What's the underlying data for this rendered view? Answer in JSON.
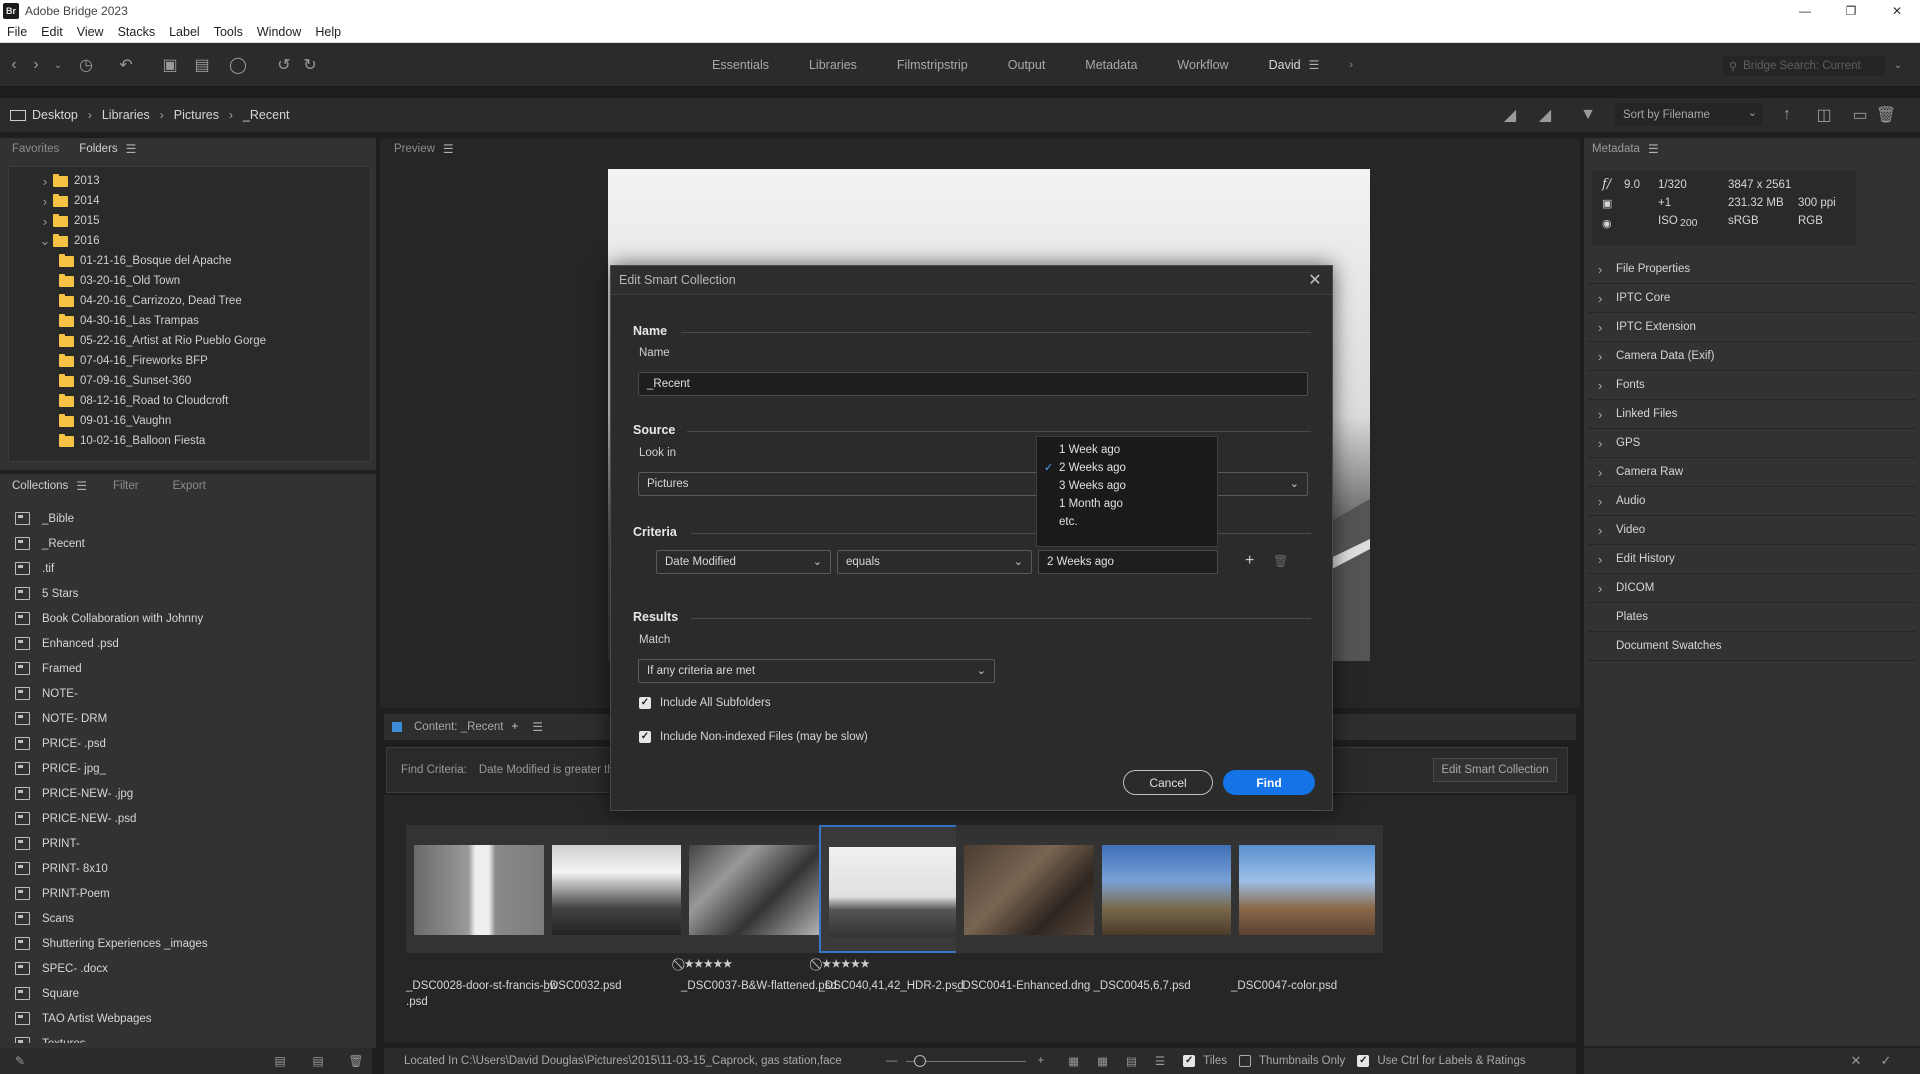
{
  "app": {
    "logo": "Br",
    "title": "Adobe Bridge 2023"
  },
  "menu": [
    "File",
    "Edit",
    "View",
    "Stacks",
    "Label",
    "Tools",
    "Window",
    "Help"
  ],
  "workspaces": [
    {
      "label": "Essentials",
      "active": false
    },
    {
      "label": "Libraries",
      "active": false
    },
    {
      "label": "Filmstripstrip",
      "active": false
    },
    {
      "label": "Output",
      "active": false
    },
    {
      "label": "Metadata",
      "active": false
    },
    {
      "label": "Workflow",
      "active": false
    },
    {
      "label": "David",
      "active": true
    }
  ],
  "search": {
    "placeholder": "Bridge Search: Current"
  },
  "breadcrumb": [
    "Desktop",
    "Libraries",
    "Pictures",
    "_Recent"
  ],
  "sort": {
    "label": "Sort by Filename"
  },
  "left_tabs": {
    "favorites": "Favorites",
    "folders": "Folders"
  },
  "folders": [
    {
      "label": "2013",
      "expanded": false,
      "indent": 0
    },
    {
      "label": "2014",
      "expanded": false,
      "indent": 0
    },
    {
      "label": "2015",
      "expanded": false,
      "indent": 0
    },
    {
      "label": "2016",
      "expanded": true,
      "indent": 0
    },
    {
      "label": "01-21-16_Bosque del Apache",
      "indent": 1
    },
    {
      "label": "03-20-16_Old Town",
      "indent": 1
    },
    {
      "label": "04-20-16_Carrizozo, Dead Tree",
      "indent": 1
    },
    {
      "label": "04-30-16_Las Trampas",
      "indent": 1
    },
    {
      "label": "05-22-16_Artist at Rio Pueblo Gorge",
      "indent": 1
    },
    {
      "label": "07-04-16_Fireworks BFP",
      "indent": 1
    },
    {
      "label": "07-09-16_Sunset-360",
      "indent": 1
    },
    {
      "label": "08-12-16_Road to Cloudcroft",
      "indent": 1
    },
    {
      "label": "09-01-16_Vaughn",
      "indent": 1
    },
    {
      "label": "10-02-16_Balloon Fiesta",
      "indent": 1
    }
  ],
  "collection_tabs": {
    "collections": "Collections",
    "filter": "Filter",
    "export": "Export"
  },
  "collections": [
    "_Bible",
    "_Recent",
    ".tif",
    "5 Stars",
    "Book Collaboration with Johnny",
    "Enhanced .psd",
    "Framed",
    "NOTE-",
    "NOTE- DRM",
    "PRICE- .psd",
    "PRICE- jpg_",
    "PRICE-NEW- .jpg",
    "PRICE-NEW- .psd",
    "PRINT-",
    "PRINT- 8x10",
    "PRINT-Poem",
    "Scans",
    "Shuttering Experiences _images",
    "SPEC- .docx",
    "Square",
    "TAO Artist Webpages",
    "Textures"
  ],
  "preview": {
    "label": "Preview"
  },
  "content": {
    "label": "Content: _Recent"
  },
  "find_bar": {
    "label": "Find Criteria:",
    "value": "Date Modified is greater th",
    "edit_button": "Edit Smart Collection"
  },
  "thumbnails": [
    {
      "caption": "_DSC0028-door-st-francis-bw .psd",
      "stars": "",
      "selected": false,
      "tone": "door"
    },
    {
      "caption": "_DSC0032.psd",
      "stars": "",
      "selected": false,
      "tone": "sky"
    },
    {
      "caption": "_DSC0037-B&W-flattened.psd",
      "stars": "⃠ ★★★★★",
      "selected": false,
      "tone": "trees"
    },
    {
      "caption": "_DSC040,41,42_HDR-2.psd",
      "stars": "⃠ ★★★★★",
      "selected": true,
      "tone": "road"
    },
    {
      "caption": "_DSC0041-Enhanced.dng",
      "stars": "",
      "selected": false,
      "tone": "rock"
    },
    {
      "caption": "_DSC0045,6,7.psd",
      "stars": "",
      "selected": false,
      "tone": "house"
    },
    {
      "caption": "_DSC0047-color.psd",
      "stars": "",
      "selected": false,
      "tone": "house2"
    }
  ],
  "status": {
    "path": "Located In C:\\Users\\David Douglas\\Pictures\\2015\\11-03-15_Caprock, gas station,face",
    "tiles": "Tiles",
    "thumbnails_only": "Thumbnails Only",
    "ctrl_hint": "Use Ctrl for Labels & Ratings"
  },
  "metadata": {
    "label": "Metadata",
    "aperture": "9.0",
    "shutter": "1/320",
    "exposure": "+1",
    "iso": "200",
    "iso_label": "ISO",
    "dimensions": "3847 x 2561",
    "filesize": "231.32 MB",
    "resolution": "300 ppi",
    "colorspace": "sRGB",
    "mode": "RGB",
    "sections": [
      "File Properties",
      "IPTC Core",
      "IPTC Extension",
      "Camera Data (Exif)",
      "Fonts",
      "Linked Files",
      "GPS",
      "Camera Raw",
      "Audio",
      "Video",
      "Edit History",
      "DICOM",
      "Plates",
      "Document Swatches"
    ]
  },
  "dialog": {
    "title": "Edit Smart Collection",
    "name_section": "Name",
    "name_label": "Name",
    "name_value": "_Recent",
    "source_section": "Source",
    "look_in_label": "Look in",
    "look_in_value": "Pictures",
    "criteria_section": "Criteria",
    "criteria_field": "Date Modified",
    "criteria_op": "equals",
    "criteria_value": "2 Weeks ago",
    "results_section": "Results",
    "match_label": "Match",
    "match_value": "If any criteria are met",
    "include_subfolders": "Include All Subfolders",
    "include_nonindexed": "Include Non-indexed Files (may be slow)",
    "cancel": "Cancel",
    "find": "Find",
    "dropdown_options": [
      {
        "label": "1 Week ago",
        "checked": false
      },
      {
        "label": "2 Weeks ago",
        "checked": true
      },
      {
        "label": "3 Weeks ago",
        "checked": false
      },
      {
        "label": "1 Month ago",
        "checked": false
      },
      {
        "label": "etc.",
        "checked": false
      }
    ]
  },
  "colors": {
    "accent": "#1473e6",
    "folder": "#f6c244",
    "selection": "#3578c9"
  }
}
